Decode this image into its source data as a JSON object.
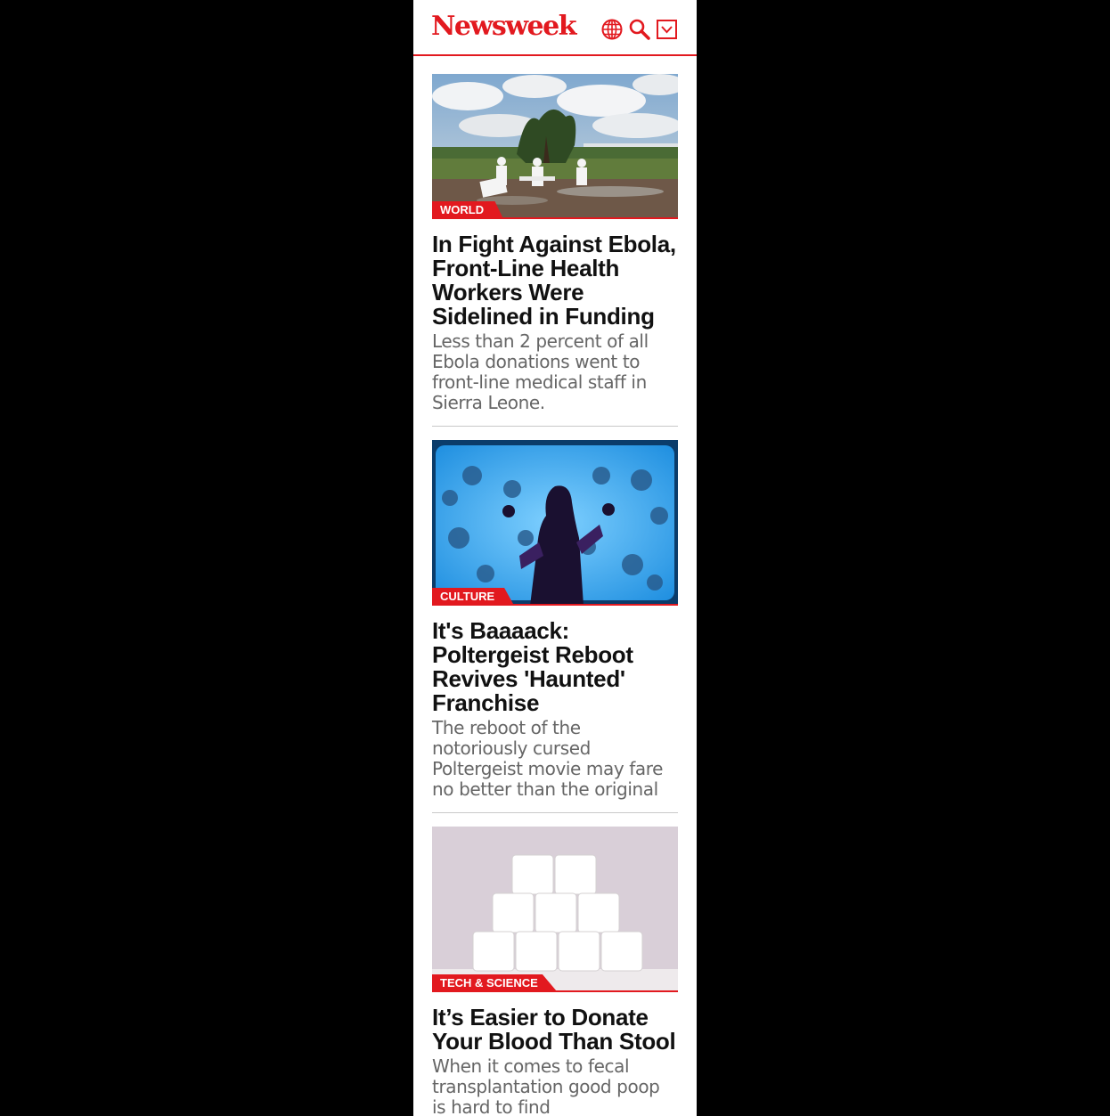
{
  "header": {
    "logo_text": "Newsweek",
    "brand_color": "#e2191f",
    "icons": [
      "globe-icon",
      "search-icon",
      "menu-dropdown-icon"
    ]
  },
  "articles": [
    {
      "section": "WORLD",
      "headline": "In Fight Against Ebola, Front-Line Health Workers Were Sidelined in Funding",
      "dek": "Less than 2 percent of all Ebola donations went to front-line medical staff in Sierra Leone."
    },
    {
      "section": "CULTURE",
      "headline": "It's Baaaack: Poltergeist Reboot Revives 'Haunted' Franchise",
      "dek": "The reboot of the notoriously cursed Poltergeist movie may fare no better than the original"
    },
    {
      "section": "TECH & SCIENCE",
      "headline": "It’s Easier to Donate Your Blood Than Stool",
      "dek": "When it comes to fecal transplantation good poop is hard to find"
    }
  ]
}
